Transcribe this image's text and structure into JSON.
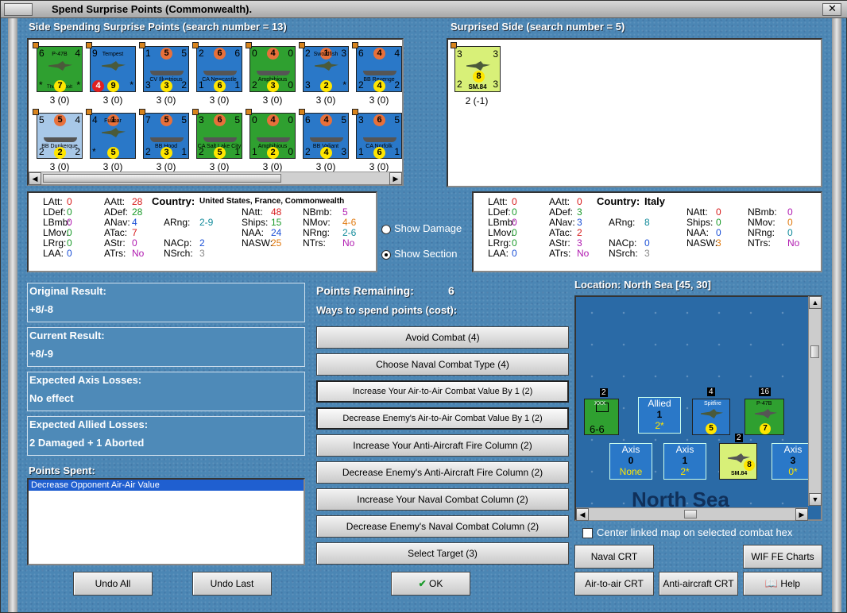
{
  "window": {
    "title": "Spend Surprise Points (Commonwealth)."
  },
  "left_panel": {
    "title": "Side Spending Surprise Points (search number = 13)"
  },
  "right_panel": {
    "title": "Surprised Side (search number = 5)"
  },
  "counters_left": [
    {
      "name": "P-47B",
      "sub": "Thunderbolt",
      "tl": "6",
      "tr": "4",
      "bl": "*",
      "br": "*",
      "circ": "7",
      "bg": "#2fa030",
      "lbl": "3 (0)",
      "kind": "plane"
    },
    {
      "name": "Tempest",
      "sub": "V",
      "tl": "9",
      "tr": "",
      "bl": "4",
      "br": "*",
      "circ": "9",
      "circ2": "4",
      "bg": "#2a78c8",
      "lbl": "3 (0)",
      "kind": "plane"
    },
    {
      "name": "CV Illustrious",
      "sub": "",
      "tl": "1",
      "tr": "5",
      "bl": "3",
      "br": "2",
      "circ": "3",
      "top": "5",
      "bg": "#2a78c8",
      "lbl": "3 (0)",
      "kind": "ship"
    },
    {
      "name": "CA Newcastle",
      "sub": "",
      "tl": "2",
      "tr": "6",
      "bl": "1",
      "br": "1",
      "circ": "6",
      "top": "6",
      "bg": "#2a78c8",
      "lbl": "3 (0)",
      "kind": "ship"
    },
    {
      "name": "Amphibious",
      "sub": "",
      "tl": "0",
      "tr": "0",
      "bl": "2",
      "br": "0",
      "circ": "3",
      "top": "4",
      "bg": "#2fa030",
      "lbl": "3 (0)",
      "kind": "ship"
    },
    {
      "name": "Swordfish",
      "sub": "",
      "tl": "2",
      "tr": "3",
      "bl": "3",
      "br": "*",
      "circ": "2",
      "top": "1",
      "bg": "#2a78c8",
      "lbl": "3 (0)",
      "kind": "plane"
    },
    {
      "name": "BB Revenge",
      "sub": "",
      "tl": "6",
      "tr": "4",
      "bl": "2",
      "br": "2",
      "circ": "4",
      "top": "4",
      "bg": "#2a78c8",
      "lbl": "3 (0)",
      "kind": "ship"
    },
    {
      "name": "BB Dunkerque",
      "sub": "",
      "tl": "5",
      "tr": "4",
      "bl": "2",
      "br": "2",
      "circ": "2",
      "top": "5",
      "bg": "#a8c8e8",
      "lbl": "3 (0)",
      "kind": "ship"
    },
    {
      "name": "Fulmar",
      "sub": "",
      "tl": "4",
      "tr": "",
      "bl": "*",
      "br": "",
      "circ": "5",
      "top": "1",
      "bg": "#2a78c8",
      "lbl": "3 (0)",
      "kind": "plane"
    },
    {
      "name": "BB Hood",
      "sub": "",
      "tl": "7",
      "tr": "5",
      "bl": "2",
      "br": "1",
      "circ": "3",
      "top": "5",
      "bg": "#2a78c8",
      "lbl": "3 (0)",
      "kind": "ship"
    },
    {
      "name": "CA Salt Lake City",
      "sub": "",
      "tl": "3",
      "tr": "5",
      "bl": "2",
      "br": "1",
      "circ": "5",
      "top": "6",
      "bg": "#2fa030",
      "lbl": "3 (0)",
      "kind": "ship"
    },
    {
      "name": "Amphibious",
      "sub": "",
      "tl": "0",
      "tr": "0",
      "bl": "1",
      "br": "0",
      "circ": "2",
      "top": "4",
      "bg": "#2fa030",
      "lbl": "3 (0)",
      "kind": "ship"
    },
    {
      "name": "BB Valiant",
      "sub": "",
      "tl": "6",
      "tr": "5",
      "bl": "2",
      "br": "3",
      "circ": "4",
      "top": "4",
      "bg": "#2a78c8",
      "lbl": "3 (0)",
      "kind": "ship"
    },
    {
      "name": "CA Norfolk",
      "sub": "",
      "tl": "3",
      "tr": "5",
      "bl": "1",
      "br": "1",
      "circ": "6",
      "top": "6",
      "bg": "#2a78c8",
      "lbl": "3 (0)",
      "kind": "ship"
    }
  ],
  "counter_right": {
    "name": "SM.84",
    "tl": "3",
    "tr": "3",
    "bl": "2",
    "br": "3",
    "circ": "8",
    "bg": "#d8f078",
    "lbl": "2 (-1)"
  },
  "stats_left": {
    "country_label": "Country:",
    "country": "United States, France, Commonwealth",
    "latt": "0",
    "ldef": "0",
    "lbmb": "0",
    "lmov": "0",
    "lrng": "0",
    "laa": "0",
    "aatt": "28",
    "adef": "28",
    "anav": "4",
    "atac": "7",
    "astr": "0",
    "atrs": "No",
    "arng": "2-9",
    "nacp": "2",
    "nsrch": "3",
    "natt": "48",
    "ships": "15",
    "naa": "24",
    "nasw": "25",
    "nbmb": "5",
    "nmov": "4-6",
    "nrng": "2-6",
    "ntrs": "No"
  },
  "stats_right": {
    "country_label": "Country:",
    "country": "Italy",
    "latt": "0",
    "ldef": "0",
    "lbmb": "0",
    "lmov": "0",
    "lrng": "0",
    "laa": "0",
    "aatt": "0",
    "adef": "3",
    "anav": "3",
    "atac": "2",
    "astr": "3",
    "atrs": "No",
    "arng": "8",
    "nacp": "0",
    "nsrch": "3",
    "natt": "0",
    "ships": "0",
    "naa": "0",
    "nasw": "3",
    "nbmb": "0",
    "nmov": "0",
    "nrng": "0",
    "ntrs": "No"
  },
  "labels": {
    "latt": "LAtt:",
    "ldef": "LDef:",
    "lbmb": "LBmb:",
    "lmov": "LMov:",
    "lrng": "LRrg:",
    "laa": "LAA:",
    "aatt": "AAtt:",
    "adef": "ADef:",
    "anav": "ANav:",
    "atac": "ATac:",
    "astr": "AStr:",
    "atrs": "ATrs:",
    "arng": "ARng:",
    "nacp": "NACp:",
    "nsrch": "NSrch:",
    "natt": "NAtt:",
    "ships": "Ships:",
    "naa": "NAA:",
    "nasw": "NASW:",
    "nbmb": "NBmb:",
    "nmov": "NMov:",
    "nrng": "NRng:",
    "ntrs": "NTrs:"
  },
  "options": {
    "show_damage": "Show Damage",
    "show_section": "Show Section",
    "selected": "show_section"
  },
  "results": {
    "original_label": "Original Result:",
    "original_value": "+8/-8",
    "current_label": "Current Result:",
    "current_value": "+8/-9",
    "axis_label": "Expected Axis Losses:",
    "axis_value": "No effect",
    "allied_label": "Expected Allied Losses:",
    "allied_value": "2 Damaged + 1 Aborted"
  },
  "points": {
    "spent_label": "Points Spent:",
    "spent_items": [
      "Decrease Opponent Air-Air Value"
    ],
    "remaining_label": "Points Remaining:",
    "remaining_value": "6",
    "ways_label": "Ways to spend points (cost):"
  },
  "actions": [
    {
      "label": "Avoid Combat (4)",
      "sel": false
    },
    {
      "label": "Choose Naval Combat Type (4)",
      "sel": false
    },
    {
      "label": "Increase Your Air-to-Air Combat Value By 1 (2)",
      "sel": true
    },
    {
      "label": "Decrease Enemy's Air-to-Air Combat Value By 1 (2)",
      "sel": true
    },
    {
      "label": "Increase Your Anti-Aircraft Fire Column (2)",
      "sel": false
    },
    {
      "label": "Decrease Enemy's Anti-Aircraft Fire Column (2)",
      "sel": false
    },
    {
      "label": "Increase Your Naval Combat Column (2)",
      "sel": false
    },
    {
      "label": "Decrease Enemy's Naval Combat Column (2)",
      "sel": false
    },
    {
      "label": "Select Target (3)",
      "sel": false
    }
  ],
  "bottom": {
    "undo_all": "Undo All",
    "undo_last": "Undo Last",
    "ok": "OK"
  },
  "map": {
    "location": "Location: North Sea [45, 30]",
    "sea_name": "North Sea",
    "allied_box": {
      "title": "Allied",
      "num": "1",
      "sub": "2*"
    },
    "axis_boxes": [
      {
        "title": "Axis",
        "num": "0",
        "sub": "None"
      },
      {
        "title": "Axis",
        "num": "1",
        "sub": "2*"
      },
      {
        "title": "Axis",
        "num": "3",
        "sub": "0*"
      }
    ],
    "stack_counts": [
      "2",
      "4",
      "16",
      "2"
    ],
    "units": [
      {
        "label": "XXX",
        "val": "6-6"
      },
      {
        "label": "Spitfire",
        "val": "5"
      },
      {
        "label": "P-47B",
        "val": "7"
      },
      {
        "label": "SM.84",
        "val": "8"
      }
    ],
    "center_linked": "Center linked map on selected combat hex"
  },
  "right_buttons": {
    "naval_crt": "Naval CRT",
    "wif_fe": "WIF FE Charts",
    "air_crt": "Air-to-air CRT",
    "aa_crt": "Anti-aircraft CRT",
    "help": "Help"
  }
}
